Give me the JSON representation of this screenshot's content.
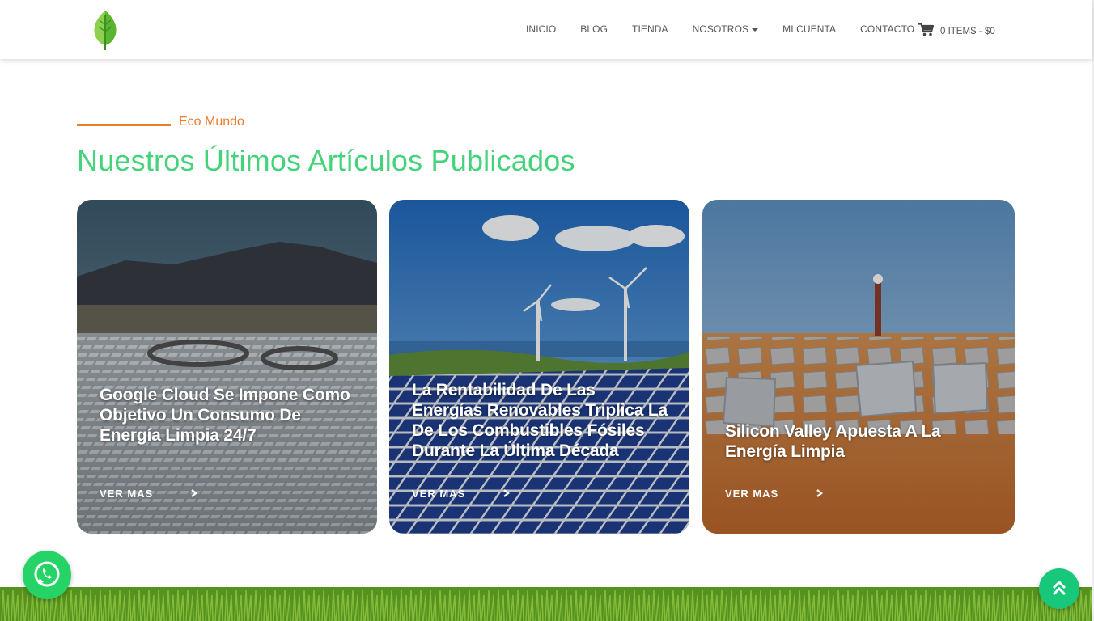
{
  "header": {
    "nav": [
      {
        "label": "INICIO"
      },
      {
        "label": "BLOG"
      },
      {
        "label": "TIENDA"
      },
      {
        "label": "NOSOTROS",
        "has_dropdown": true
      },
      {
        "label": "MI CUENTA"
      },
      {
        "label": "CONTACTO"
      }
    ],
    "cart": {
      "icon": "cart-icon",
      "label": "0 ITEMS - $0"
    }
  },
  "section": {
    "eyebrow": "Eco Mundo",
    "title": "Nuestros Últimos Artículos Publicados"
  },
  "articles": [
    {
      "title": "Google Cloud Se Impone Como Objetivo Un Consumo De Energía Limpia 24/7",
      "cta": "VER MAS",
      "image": "solar-field-mountains"
    },
    {
      "title": "La Rentabilidad De Las Energías Renovables Triplica La De Los Combustibles Fósiles Durante La Última Década",
      "cta": "VER MAS",
      "image": "wind-turbines-solar-panels"
    },
    {
      "title": "Silicon Valley Apuesta A La Energía Limpia",
      "cta": "VER MAS",
      "image": "solar-tower-heliostats"
    }
  ],
  "colors": {
    "accent_orange": "#ea7d2e",
    "title_green": "#44d27b",
    "whatsapp_green": "#25d366",
    "totop_green": "#18c77a"
  },
  "floating": {
    "whatsapp_icon": "whatsapp-icon",
    "totop_icon": "double-chevron-up-icon"
  }
}
